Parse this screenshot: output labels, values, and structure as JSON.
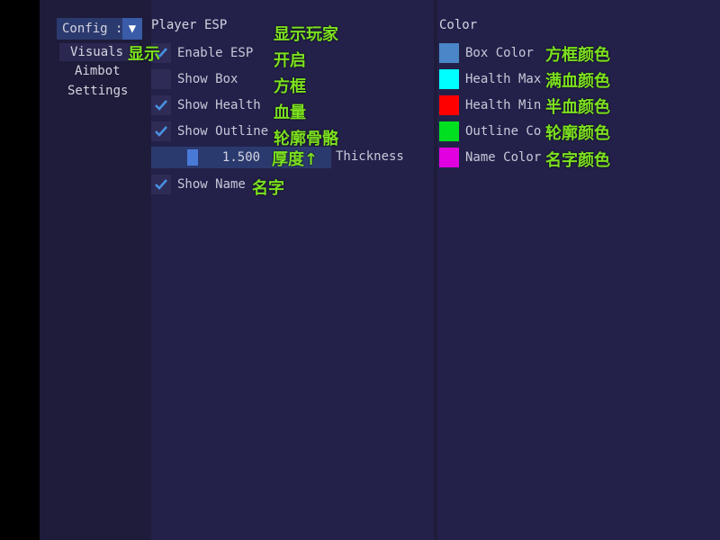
{
  "sidebar": {
    "combo": {
      "value": "Config :",
      "arrow": "▼"
    },
    "tabs": [
      {
        "label": "Visuals"
      },
      {
        "label": "Aimbot"
      },
      {
        "label": "Settings"
      }
    ]
  },
  "esp": {
    "header": "Player ESP",
    "enable_esp": {
      "label": "Enable ESP",
      "checked": true
    },
    "show_box": {
      "label": "Show Box",
      "checked": false
    },
    "show_health": {
      "label": "Show Health",
      "checked": true
    },
    "show_outline": {
      "label": "Show Outline",
      "checked": true
    },
    "thickness": {
      "value": "1.500",
      "label": "Thickness",
      "fraction": 0.2
    },
    "show_name": {
      "label": "Show Name",
      "checked": true
    }
  },
  "color": {
    "header": "Color",
    "items": [
      {
        "label": "Box Color",
        "color": "#4a86c8"
      },
      {
        "label": "Health Max",
        "color": "#00ffff"
      },
      {
        "label": "Health Min C",
        "color": "#ff0000"
      },
      {
        "label": "Outline Co",
        "color": "#00e020"
      },
      {
        "label": "Name Color",
        "color": "#e000e0"
      }
    ]
  },
  "annotations": {
    "visuals": "显示",
    "player_esp": "显示玩家",
    "enable": "开启",
    "box": "方框",
    "health": "血量",
    "outline": "轮廓骨骼",
    "thickness": "厚度↑",
    "name": "名字",
    "box_color": "方框颜色",
    "health_max": "满血颜色",
    "health_min": "半血颜色",
    "outline_color": "轮廓颜色",
    "name_color": "名字颜色"
  },
  "theme": {
    "check_color": "#4a90e0",
    "annotation_color": "#7ce020"
  }
}
